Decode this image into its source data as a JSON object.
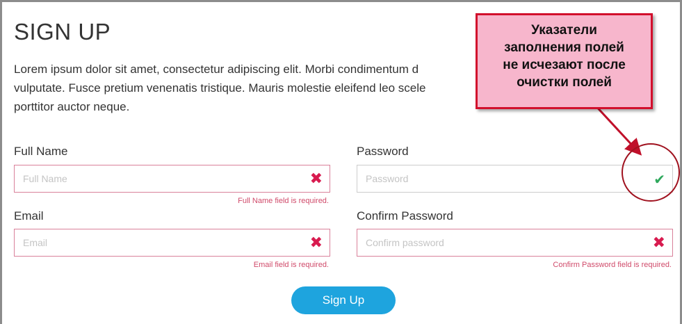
{
  "form": {
    "title": "SIGN UP",
    "intro": "Lorem ipsum dolor sit amet, consectetur adipiscing elit. Morbi condimentum d\nvulputate. Fusce pretium venenatis tristique. Mauris molestie eleifend leo scele\nporttitor auctor neque.",
    "full_name": {
      "label": "Full Name",
      "placeholder": "Full Name",
      "error": "Full Name field is required.",
      "status_icon": "x-icon"
    },
    "email": {
      "label": "Email",
      "placeholder": "Email",
      "error": "Email field is required.",
      "status_icon": "x-icon"
    },
    "password": {
      "label": "Password",
      "placeholder": "Password",
      "status_icon": "check-icon"
    },
    "confirm_password": {
      "label": "Confirm Password",
      "placeholder": "Confirm password",
      "error": "Confirm Password field is required.",
      "status_icon": "x-icon"
    },
    "submit_label": "Sign Up"
  },
  "annotation": {
    "text": "Указатели\nзаполнения полей\nне исчезают после\nочистки полей"
  },
  "colors": {
    "error": "#d81b4f",
    "success": "#2ea85c",
    "button": "#1ea4de",
    "callout_fill": "#f7b6cc",
    "callout_border": "#d20f2c"
  },
  "glyphs": {
    "x": "✖",
    "check": "✔"
  }
}
